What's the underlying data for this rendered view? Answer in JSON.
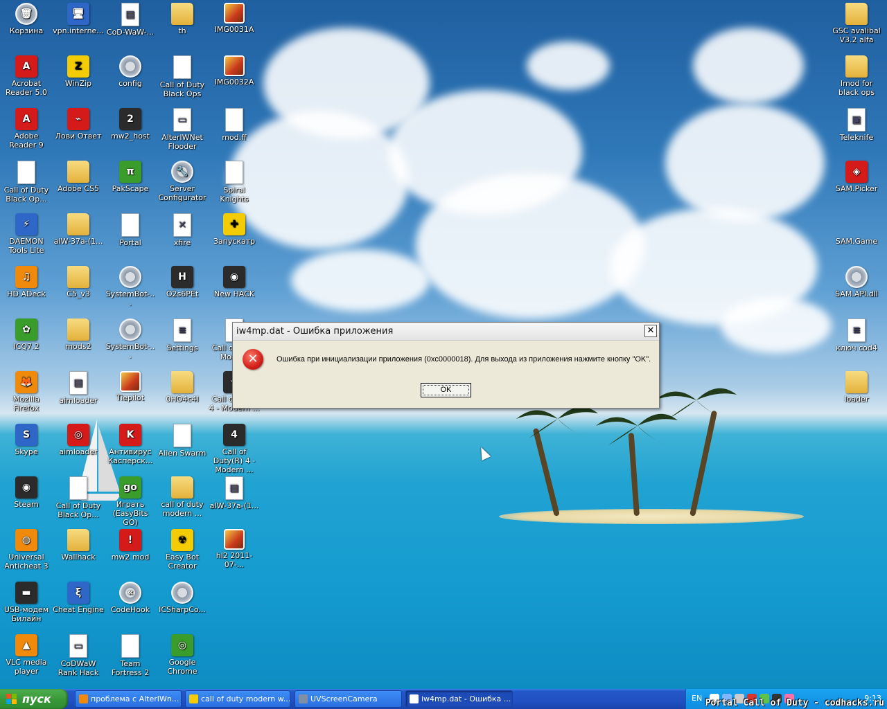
{
  "desktop": {
    "icons": [
      {
        "label": "Корзина",
        "icon": "recycle-bin-icon",
        "style": "gear",
        "glyph": "🗑"
      },
      {
        "label": "vpn.interne...",
        "icon": "network-connection-icon",
        "style": "blue",
        "glyph": "🖥"
      },
      {
        "label": "CoD-WaW-...",
        "icon": "archive-icon",
        "style": "file",
        "glyph": "▤"
      },
      {
        "label": "th",
        "icon": "folder-icon",
        "style": "folder",
        "glyph": ""
      },
      {
        "label": "IMG0031A",
        "icon": "image-icon",
        "style": "photo",
        "glyph": ""
      },
      {
        "label": "Acrobat Reader 5.0",
        "icon": "acrobat-icon",
        "style": "red",
        "glyph": "A"
      },
      {
        "label": "WinZip",
        "icon": "winzip-icon",
        "style": "yellow",
        "glyph": "Z"
      },
      {
        "label": "config",
        "icon": "config-gear-icon",
        "style": "gear",
        "glyph": ""
      },
      {
        "label": "Call of Duty Black Ops",
        "icon": "file-icon",
        "style": "file",
        "glyph": ""
      },
      {
        "label": "IMG0032A",
        "icon": "image-icon",
        "style": "photo",
        "glyph": ""
      },
      {
        "label": "Adobe Reader 9",
        "icon": "adobe-reader-icon",
        "style": "red",
        "glyph": "A"
      },
      {
        "label": "Лови Ответ",
        "icon": "lovi-otvet-icon",
        "style": "red",
        "glyph": "⌁"
      },
      {
        "label": "mw2_host",
        "icon": "mw2-host-icon",
        "style": "dark",
        "glyph": "2"
      },
      {
        "label": "AlterIWNet Flooder",
        "icon": "app-window-icon",
        "style": "file",
        "glyph": "▭"
      },
      {
        "label": "mod.ff",
        "icon": "file-icon",
        "style": "file",
        "glyph": ""
      },
      {
        "label": "Call of Duty Black Op...",
        "icon": "file-icon",
        "style": "file",
        "glyph": ""
      },
      {
        "label": "Adobe CS5",
        "icon": "folder-icon",
        "style": "folder",
        "glyph": ""
      },
      {
        "label": "PakScape",
        "icon": "pakscape-icon",
        "style": "green",
        "glyph": "π"
      },
      {
        "label": "Server Configurator",
        "icon": "wrench-icon",
        "style": "gear",
        "glyph": "🔧"
      },
      {
        "label": "Spiral Knights",
        "icon": "file-icon",
        "style": "file",
        "glyph": ""
      },
      {
        "label": "DAEMON Tools Lite",
        "icon": "daemon-tools-icon",
        "style": "blue",
        "glyph": "⚡"
      },
      {
        "label": "aIW-37a-(1...",
        "icon": "folder-icon",
        "style": "folder",
        "glyph": ""
      },
      {
        "label": "Portal",
        "icon": "file-icon",
        "style": "file",
        "glyph": ""
      },
      {
        "label": "xfire",
        "icon": "xfire-icon",
        "style": "file",
        "glyph": "✕"
      },
      {
        "label": "Запускатр",
        "icon": "launcher-icon",
        "style": "yellow",
        "glyph": "✚"
      },
      {
        "label": "HD ADeck",
        "icon": "hd-adeck-icon",
        "style": "orange",
        "glyph": "♫"
      },
      {
        "label": "C5_v3",
        "icon": "folder-icon",
        "style": "folder",
        "glyph": ""
      },
      {
        "label": "SystemBot-...",
        "icon": "config-gear-icon",
        "style": "gear",
        "glyph": ""
      },
      {
        "label": "O2s6PEt",
        "icon": "o2s6pet-icon",
        "style": "dark",
        "glyph": "H"
      },
      {
        "label": "New HACK",
        "icon": "steam-icon",
        "style": "dark",
        "glyph": "◉"
      },
      {
        "label": "ICQ7.2",
        "icon": "icq-icon",
        "style": "green",
        "glyph": "✿"
      },
      {
        "label": "mods2",
        "icon": "folder-icon",
        "style": "folder",
        "glyph": ""
      },
      {
        "label": "SystemBot-...",
        "icon": "config-gear-icon",
        "style": "gear",
        "glyph": ""
      },
      {
        "label": "Settings",
        "icon": "settings-doc-icon",
        "style": "file",
        "glyph": "≡"
      },
      {
        "label": "Call of Duty Mode...",
        "icon": "file-icon",
        "style": "file",
        "glyph": ""
      },
      {
        "label": "Mozilla Firefox",
        "icon": "firefox-icon",
        "style": "orange",
        "glyph": "🦊"
      },
      {
        "label": "aimloader",
        "icon": "aimloader-doc-icon",
        "style": "file",
        "glyph": "▤"
      },
      {
        "label": "Tiepilot",
        "icon": "image-icon",
        "style": "photo",
        "glyph": ""
      },
      {
        "label": "0HO4c4I",
        "icon": "folder-icon",
        "style": "folder",
        "glyph": ""
      },
      {
        "label": "Call of Duty 4 - Modern ...",
        "icon": "cod4-icon",
        "style": "dark",
        "glyph": "★"
      },
      {
        "label": "Skype",
        "icon": "skype-icon",
        "style": "blue",
        "glyph": "S"
      },
      {
        "label": "aimloader",
        "icon": "aimloader-icon",
        "style": "red",
        "glyph": "◎"
      },
      {
        "label": "Антивирус Касперск...",
        "icon": "kaspersky-icon",
        "style": "red",
        "glyph": "K"
      },
      {
        "label": "Alien Swarm",
        "icon": "file-icon",
        "style": "file",
        "glyph": ""
      },
      {
        "label": "Call of Duty(R) 4 - Modern ...",
        "icon": "cod4-icon",
        "style": "dark",
        "glyph": "4"
      },
      {
        "label": "Steam",
        "icon": "steam-icon",
        "style": "dark",
        "glyph": "◉"
      },
      {
        "label": "Call of Duty Black Op...",
        "icon": "file-icon",
        "style": "file",
        "glyph": ""
      },
      {
        "label": "Играть (EasyBits GO)",
        "icon": "easybits-go-icon",
        "style": "green",
        "glyph": "go"
      },
      {
        "label": "call of duty modern ...",
        "icon": "folder-icon",
        "style": "folder",
        "glyph": ""
      },
      {
        "label": "aIW-37a-(1...",
        "icon": "archive-icon",
        "style": "file",
        "glyph": "▤"
      },
      {
        "label": "Universal Anticheat 3",
        "icon": "anticheat-icon",
        "style": "orange",
        "glyph": "◍"
      },
      {
        "label": "Wallhack",
        "icon": "folder-icon",
        "style": "folder",
        "glyph": ""
      },
      {
        "label": "mw2 mod",
        "icon": "mw2-mod-icon",
        "style": "red",
        "glyph": "!"
      },
      {
        "label": "Easy Bot Creator",
        "icon": "radiation-icon",
        "style": "yellow",
        "glyph": "☢"
      },
      {
        "label": "hl2 2011-07-...",
        "icon": "image-icon",
        "style": "photo",
        "glyph": ""
      },
      {
        "label": "USB-модем Билайн",
        "icon": "usb-modem-icon",
        "style": "dark",
        "glyph": "▬"
      },
      {
        "label": "Cheat Engine",
        "icon": "cheat-engine-icon",
        "style": "blue",
        "glyph": "ξ"
      },
      {
        "label": "CodeHook",
        "icon": "codehook-icon",
        "style": "gear",
        "glyph": "«"
      },
      {
        "label": "ICSharpCo...",
        "icon": "config-gear-icon",
        "style": "gear",
        "glyph": ""
      },
      {
        "label": "",
        "icon": "",
        "style": "",
        "glyph": ""
      },
      {
        "label": "VLC media player",
        "icon": "vlc-icon",
        "style": "orange",
        "glyph": "▲"
      },
      {
        "label": "CoDWaW Rank Hack",
        "icon": "app-window-icon",
        "style": "file",
        "glyph": "▭"
      },
      {
        "label": "Team Fortress 2",
        "icon": "file-icon",
        "style": "file",
        "glyph": ""
      },
      {
        "label": "Google Chrome",
        "icon": "chrome-icon",
        "style": "green",
        "glyph": "◎"
      }
    ],
    "right_icons": [
      {
        "label": "GSC avalibal V3.2 alfa",
        "icon": "folder-icon",
        "style": "folder",
        "glyph": ""
      },
      {
        "label": "Imod for black ops",
        "icon": "folder-icon",
        "style": "folder",
        "glyph": ""
      },
      {
        "label": "Teleknife",
        "icon": "teleknife-icon",
        "style": "file",
        "glyph": "▣"
      },
      {
        "label": "SAM.Picker",
        "icon": "sam-picker-icon",
        "style": "red",
        "glyph": "◈"
      },
      {
        "label": "SAM.Game",
        "icon": "",
        "style": "",
        "glyph": ""
      },
      {
        "label": "SAM.API.dll",
        "icon": "dll-gear-icon",
        "style": "gear",
        "glyph": ""
      },
      {
        "label": "ключ cod4",
        "icon": "text-file-icon",
        "style": "file",
        "glyph": "≡"
      },
      {
        "label": "loader",
        "icon": "folder-icon",
        "style": "folder",
        "glyph": ""
      }
    ]
  },
  "dialog": {
    "title": "iw4mp.dat - Ошибка приложения",
    "close_glyph": "✕",
    "error_glyph": "✕",
    "message": "Ошибка при инициализации приложения (0xc0000018). Для выхода из приложения нажмите кнопку \"OK\".",
    "ok_label": "OK"
  },
  "taskbar": {
    "start_label": "пуск",
    "tasks": [
      {
        "label": "проблема с AlterIWn...",
        "icon": "firefox-icon",
        "color": "#f08a0c"
      },
      {
        "label": "call of duty modern w...",
        "icon": "folder-icon",
        "color": "#f3cc05"
      },
      {
        "label": "UVScreenCamera",
        "icon": "camera-icon",
        "color": "#7f8fa6"
      },
      {
        "label": "iw4mp.dat - Ошибка ...",
        "icon": "window-icon",
        "color": "#ffffff"
      }
    ],
    "tray": {
      "lang": "EN",
      "icons": [
        {
          "name": "b-icon",
          "color": "#ffffff"
        },
        {
          "name": "network-icon",
          "color": "#7fb8ff"
        },
        {
          "name": "speaker-icon",
          "color": "#cccccc"
        },
        {
          "name": "shield-icon",
          "color": "#d9342b"
        },
        {
          "name": "icq-tray-icon",
          "color": "#5fc34a"
        },
        {
          "name": "steam-tray-icon",
          "color": "#333333"
        },
        {
          "name": "sam-tray-icon",
          "color": "#ff6fa8"
        }
      ],
      "clock": "9:13"
    }
  },
  "watermark": "Portal Call of Duty - codhacks.ru"
}
